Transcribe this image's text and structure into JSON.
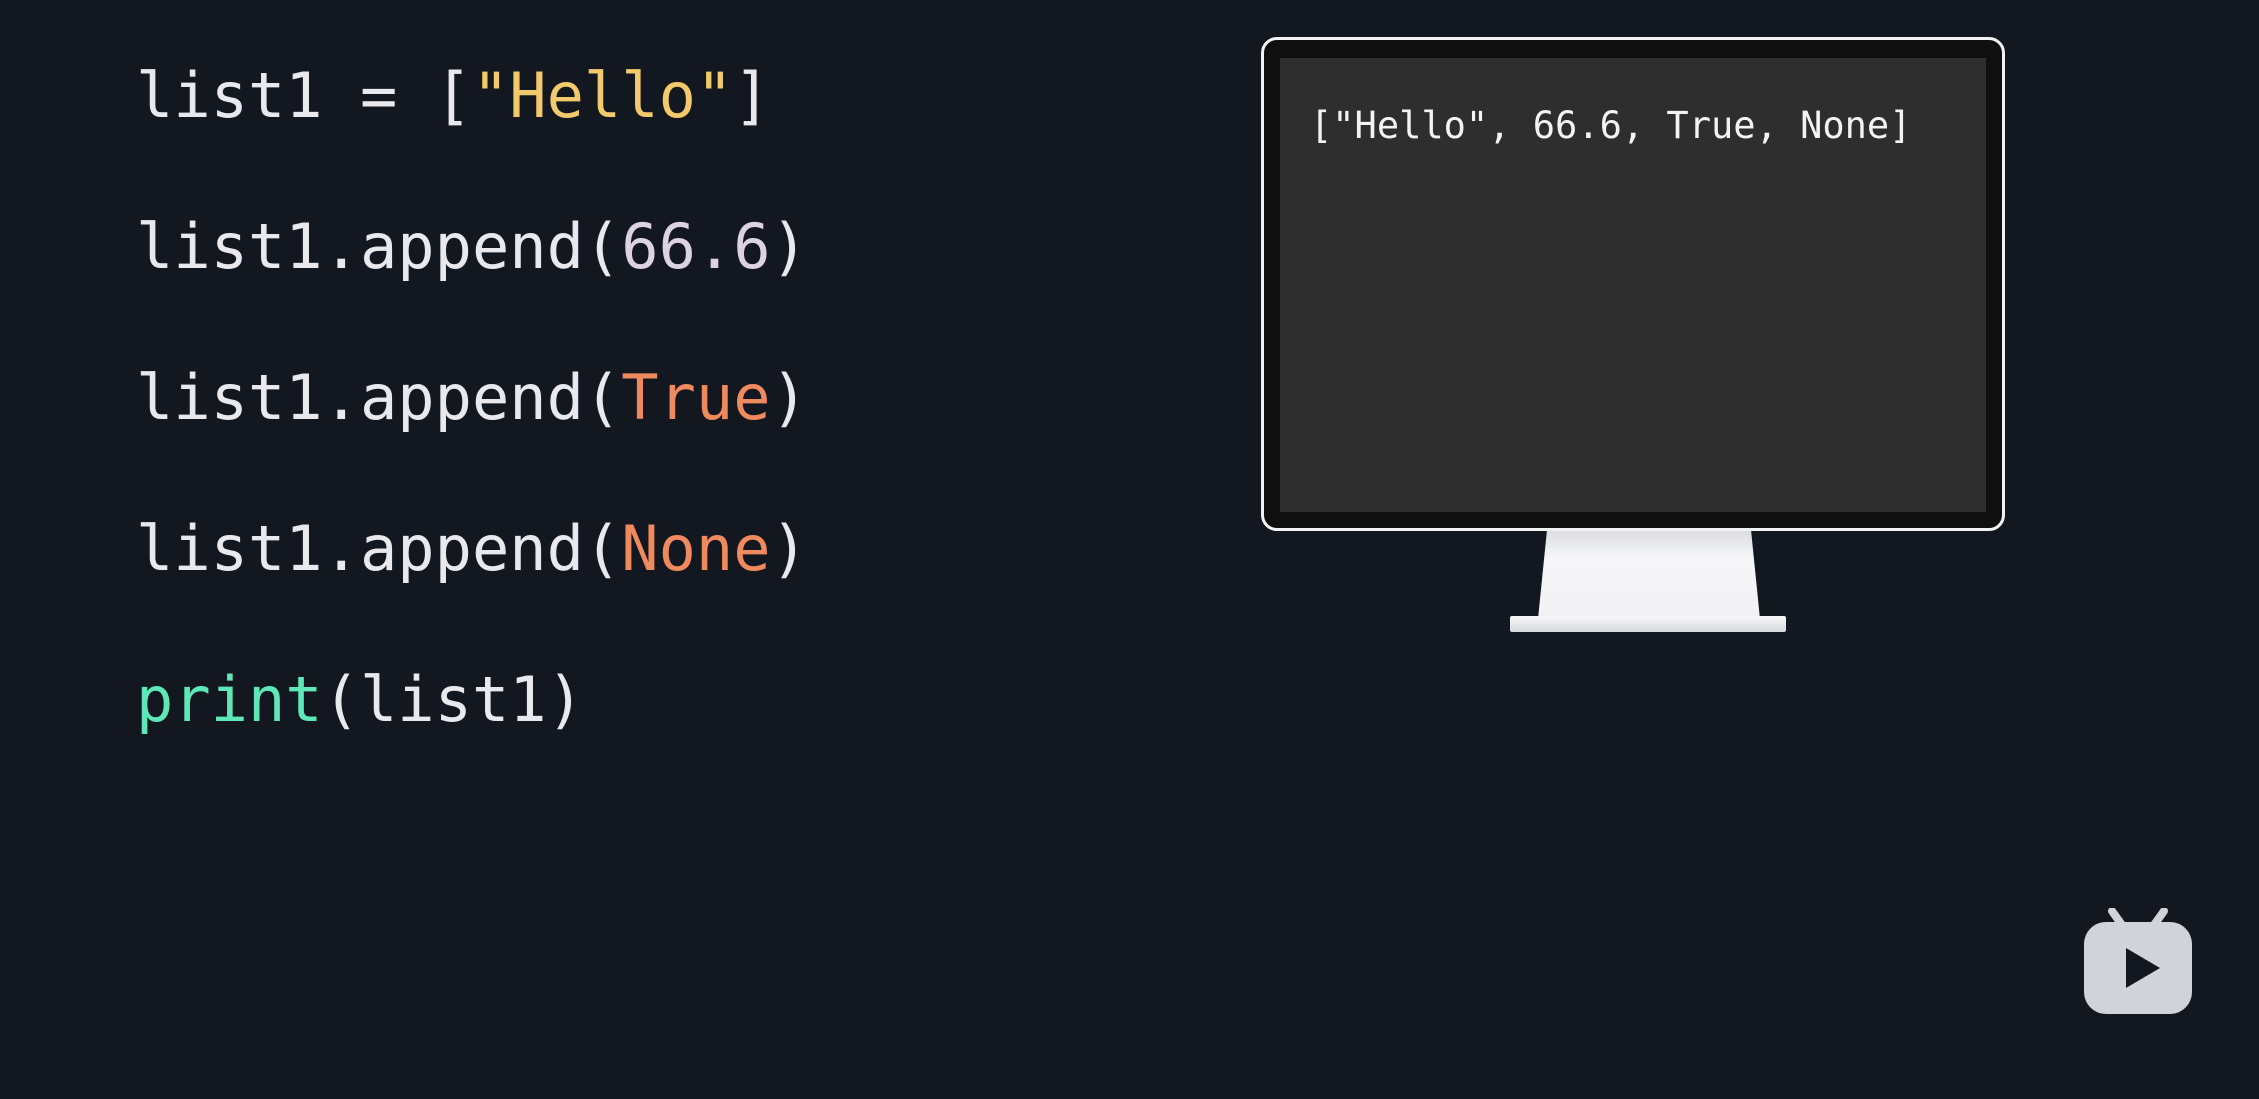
{
  "code": {
    "lines": [
      {
        "tokens": [
          {
            "text": "list1 = [",
            "kind": "plain"
          },
          {
            "text": "\"Hello\"",
            "kind": "string"
          },
          {
            "text": "]",
            "kind": "plain"
          }
        ]
      },
      {
        "tokens": [
          {
            "text": "list1.append(",
            "kind": "plain"
          },
          {
            "text": "66.6",
            "kind": "number"
          },
          {
            "text": ")",
            "kind": "plain"
          }
        ]
      },
      {
        "tokens": [
          {
            "text": "list1.append(",
            "kind": "plain"
          },
          {
            "text": "True",
            "kind": "keyword"
          },
          {
            "text": ")",
            "kind": "plain"
          }
        ]
      },
      {
        "tokens": [
          {
            "text": "list1.append(",
            "kind": "plain"
          },
          {
            "text": "None",
            "kind": "keyword"
          },
          {
            "text": ")",
            "kind": "plain"
          }
        ]
      },
      {
        "tokens": [
          {
            "text": "print",
            "kind": "builtin"
          },
          {
            "text": "(list1)",
            "kind": "plain"
          }
        ]
      }
    ]
  },
  "monitor": {
    "output": "[\"Hello\", 66.6, True, None]"
  },
  "logo": {
    "icon": "tv-play-icon"
  },
  "colors": {
    "background": "#121720",
    "plain": "#e9e9ed",
    "string": "#f2c96b",
    "number": "#dcd2e4",
    "keyword": "#ee8a5e",
    "builtin": "#5ee8b8"
  }
}
